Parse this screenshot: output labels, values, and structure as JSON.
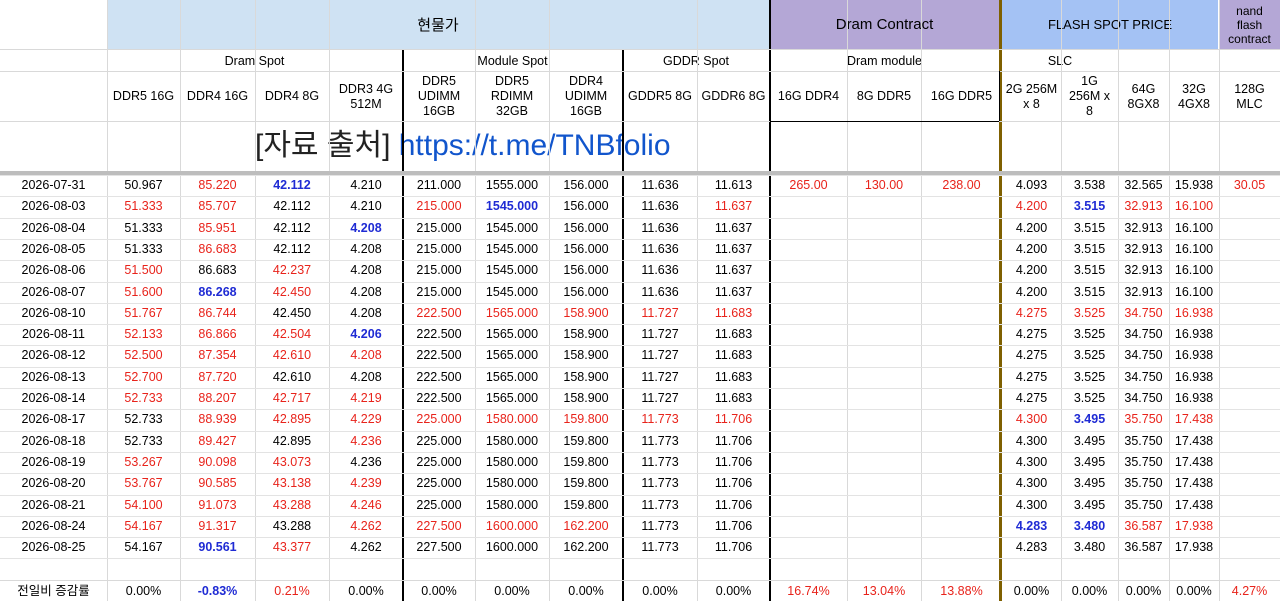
{
  "groups": {
    "spot": "현물가",
    "contract": "Dram Contract",
    "flash": "FLASH SPOT PRICE",
    "nand": "nand flash contract"
  },
  "subgroups": {
    "dram_spot": "Dram Spot",
    "module_spot": "Module Spot",
    "gddr_spot": "GDDR Spot",
    "dram_module": "Dram module",
    "slc": "SLC"
  },
  "columns": [
    "DDR5 16G",
    "DDR4 16G",
    "DDR4 8G",
    "DDR3 4G 512M",
    "DDR5 UDIMM 16GB",
    "DDR5 RDIMM 32GB",
    "DDR4 UDIMM 16GB",
    "GDDR5 8G",
    "GDDR6 8G",
    "16G DDR4",
    "8G DDR5",
    "16G DDR5",
    "2G 256M x 8",
    "1G 256M x 8",
    "64G 8GX8",
    "32G 4GX8",
    "128G MLC"
  ],
  "source": {
    "label": "[자료 출처]",
    "link": "https://t.me/TNBfolio"
  },
  "rows": [
    {
      "date": "2026-07-31",
      "v": [
        "50.967",
        "85.220",
        "42.112",
        "4.210",
        "211.000",
        "1555.000",
        "156.000",
        "11.636",
        "11.613",
        "265.00",
        "130.00",
        "238.00",
        "4.093",
        "3.538",
        "32.565",
        "15.938",
        "30.05"
      ],
      "c": [
        "k",
        "r",
        "b",
        "k",
        "k",
        "k",
        "k",
        "k",
        "k",
        "r",
        "r",
        "r",
        "k",
        "k",
        "k",
        "k",
        "r"
      ]
    },
    {
      "date": "2026-08-03",
      "v": [
        "51.333",
        "85.707",
        "42.112",
        "4.210",
        "215.000",
        "1545.000",
        "156.000",
        "11.636",
        "11.637",
        "",
        "",
        "",
        "4.200",
        "3.515",
        "32.913",
        "16.100",
        ""
      ],
      "c": [
        "r",
        "r",
        "k",
        "k",
        "r",
        "b",
        "k",
        "k",
        "r",
        "k",
        "k",
        "k",
        "r",
        "b",
        "r",
        "r",
        "k"
      ]
    },
    {
      "date": "2026-08-04",
      "v": [
        "51.333",
        "85.951",
        "42.112",
        "4.208",
        "215.000",
        "1545.000",
        "156.000",
        "11.636",
        "11.637",
        "",
        "",
        "",
        "4.200",
        "3.515",
        "32.913",
        "16.100",
        ""
      ],
      "c": [
        "k",
        "r",
        "k",
        "b",
        "k",
        "k",
        "k",
        "k",
        "k",
        "k",
        "k",
        "k",
        "k",
        "k",
        "k",
        "k",
        "k"
      ]
    },
    {
      "date": "2026-08-05",
      "v": [
        "51.333",
        "86.683",
        "42.112",
        "4.208",
        "215.000",
        "1545.000",
        "156.000",
        "11.636",
        "11.637",
        "",
        "",
        "",
        "4.200",
        "3.515",
        "32.913",
        "16.100",
        ""
      ],
      "c": [
        "k",
        "r",
        "k",
        "k",
        "k",
        "k",
        "k",
        "k",
        "k",
        "k",
        "k",
        "k",
        "k",
        "k",
        "k",
        "k",
        "k"
      ]
    },
    {
      "date": "2026-08-06",
      "v": [
        "51.500",
        "86.683",
        "42.237",
        "4.208",
        "215.000",
        "1545.000",
        "156.000",
        "11.636",
        "11.637",
        "",
        "",
        "",
        "4.200",
        "3.515",
        "32.913",
        "16.100",
        ""
      ],
      "c": [
        "r",
        "k",
        "r",
        "k",
        "k",
        "k",
        "k",
        "k",
        "k",
        "k",
        "k",
        "k",
        "k",
        "k",
        "k",
        "k",
        "k"
      ]
    },
    {
      "date": "2026-08-07",
      "v": [
        "51.600",
        "86.268",
        "42.450",
        "4.208",
        "215.000",
        "1545.000",
        "156.000",
        "11.636",
        "11.637",
        "",
        "",
        "",
        "4.200",
        "3.515",
        "32.913",
        "16.100",
        ""
      ],
      "c": [
        "r",
        "b",
        "r",
        "k",
        "k",
        "k",
        "k",
        "k",
        "k",
        "k",
        "k",
        "k",
        "k",
        "k",
        "k",
        "k",
        "k"
      ]
    },
    {
      "date": "2026-08-10",
      "v": [
        "51.767",
        "86.744",
        "42.450",
        "4.208",
        "222.500",
        "1565.000",
        "158.900",
        "11.727",
        "11.683",
        "",
        "",
        "",
        "4.275",
        "3.525",
        "34.750",
        "16.938",
        ""
      ],
      "c": [
        "r",
        "r",
        "k",
        "k",
        "r",
        "r",
        "r",
        "r",
        "r",
        "k",
        "k",
        "k",
        "r",
        "r",
        "r",
        "r",
        "k"
      ]
    },
    {
      "date": "2026-08-11",
      "v": [
        "52.133",
        "86.866",
        "42.504",
        "4.206",
        "222.500",
        "1565.000",
        "158.900",
        "11.727",
        "11.683",
        "",
        "",
        "",
        "4.275",
        "3.525",
        "34.750",
        "16.938",
        ""
      ],
      "c": [
        "r",
        "r",
        "r",
        "b",
        "k",
        "k",
        "k",
        "k",
        "k",
        "k",
        "k",
        "k",
        "k",
        "k",
        "k",
        "k",
        "k"
      ]
    },
    {
      "date": "2026-08-12",
      "v": [
        "52.500",
        "87.354",
        "42.610",
        "4.208",
        "222.500",
        "1565.000",
        "158.900",
        "11.727",
        "11.683",
        "",
        "",
        "",
        "4.275",
        "3.525",
        "34.750",
        "16.938",
        ""
      ],
      "c": [
        "r",
        "r",
        "r",
        "r",
        "k",
        "k",
        "k",
        "k",
        "k",
        "k",
        "k",
        "k",
        "k",
        "k",
        "k",
        "k",
        "k"
      ]
    },
    {
      "date": "2026-08-13",
      "v": [
        "52.700",
        "87.720",
        "42.610",
        "4.208",
        "222.500",
        "1565.000",
        "158.900",
        "11.727",
        "11.683",
        "",
        "",
        "",
        "4.275",
        "3.525",
        "34.750",
        "16.938",
        ""
      ],
      "c": [
        "r",
        "r",
        "k",
        "k",
        "k",
        "k",
        "k",
        "k",
        "k",
        "k",
        "k",
        "k",
        "k",
        "k",
        "k",
        "k",
        "k"
      ]
    },
    {
      "date": "2026-08-14",
      "v": [
        "52.733",
        "88.207",
        "42.717",
        "4.219",
        "222.500",
        "1565.000",
        "158.900",
        "11.727",
        "11.683",
        "",
        "",
        "",
        "4.275",
        "3.525",
        "34.750",
        "16.938",
        ""
      ],
      "c": [
        "r",
        "r",
        "r",
        "r",
        "k",
        "k",
        "k",
        "k",
        "k",
        "k",
        "k",
        "k",
        "k",
        "k",
        "k",
        "k",
        "k"
      ]
    },
    {
      "date": "2026-08-17",
      "v": [
        "52.733",
        "88.939",
        "42.895",
        "4.229",
        "225.000",
        "1580.000",
        "159.800",
        "11.773",
        "11.706",
        "",
        "",
        "",
        "4.300",
        "3.495",
        "35.750",
        "17.438",
        ""
      ],
      "c": [
        "k",
        "r",
        "r",
        "r",
        "r",
        "r",
        "r",
        "r",
        "r",
        "k",
        "k",
        "k",
        "r",
        "b",
        "r",
        "r",
        "k"
      ]
    },
    {
      "date": "2026-08-18",
      "v": [
        "52.733",
        "89.427",
        "42.895",
        "4.236",
        "225.000",
        "1580.000",
        "159.800",
        "11.773",
        "11.706",
        "",
        "",
        "",
        "4.300",
        "3.495",
        "35.750",
        "17.438",
        ""
      ],
      "c": [
        "k",
        "r",
        "k",
        "r",
        "k",
        "k",
        "k",
        "k",
        "k",
        "k",
        "k",
        "k",
        "k",
        "k",
        "k",
        "k",
        "k"
      ]
    },
    {
      "date": "2026-08-19",
      "v": [
        "53.267",
        "90.098",
        "43.073",
        "4.236",
        "225.000",
        "1580.000",
        "159.800",
        "11.773",
        "11.706",
        "",
        "",
        "",
        "4.300",
        "3.495",
        "35.750",
        "17.438",
        ""
      ],
      "c": [
        "r",
        "r",
        "r",
        "k",
        "k",
        "k",
        "k",
        "k",
        "k",
        "k",
        "k",
        "k",
        "k",
        "k",
        "k",
        "k",
        "k"
      ]
    },
    {
      "date": "2026-08-20",
      "v": [
        "53.767",
        "90.585",
        "43.138",
        "4.239",
        "225.000",
        "1580.000",
        "159.800",
        "11.773",
        "11.706",
        "",
        "",
        "",
        "4.300",
        "3.495",
        "35.750",
        "17.438",
        ""
      ],
      "c": [
        "r",
        "r",
        "r",
        "r",
        "k",
        "k",
        "k",
        "k",
        "k",
        "k",
        "k",
        "k",
        "k",
        "k",
        "k",
        "k",
        "k"
      ]
    },
    {
      "date": "2026-08-21",
      "v": [
        "54.100",
        "91.073",
        "43.288",
        "4.246",
        "225.000",
        "1580.000",
        "159.800",
        "11.773",
        "11.706",
        "",
        "",
        "",
        "4.300",
        "3.495",
        "35.750",
        "17.438",
        ""
      ],
      "c": [
        "r",
        "r",
        "r",
        "r",
        "k",
        "k",
        "k",
        "k",
        "k",
        "k",
        "k",
        "k",
        "k",
        "k",
        "k",
        "k",
        "k"
      ]
    },
    {
      "date": "2026-08-24",
      "v": [
        "54.167",
        "91.317",
        "43.288",
        "4.262",
        "227.500",
        "1600.000",
        "162.200",
        "11.773",
        "11.706",
        "",
        "",
        "",
        "4.283",
        "3.480",
        "36.587",
        "17.938",
        ""
      ],
      "c": [
        "r",
        "r",
        "k",
        "r",
        "r",
        "r",
        "r",
        "k",
        "k",
        "k",
        "k",
        "k",
        "b",
        "b",
        "r",
        "r",
        "k"
      ]
    },
    {
      "date": "2026-08-25",
      "v": [
        "54.167",
        "90.561",
        "43.377",
        "4.262",
        "227.500",
        "1600.000",
        "162.200",
        "11.773",
        "11.706",
        "",
        "",
        "",
        "4.283",
        "3.480",
        "36.587",
        "17.938",
        ""
      ],
      "c": [
        "k",
        "b",
        "r",
        "k",
        "k",
        "k",
        "k",
        "k",
        "k",
        "k",
        "k",
        "k",
        "k",
        "k",
        "k",
        "k",
        "k"
      ]
    }
  ],
  "change": {
    "label": "전일비 증감률",
    "v": [
      "0.00%",
      "-0.83%",
      "0.21%",
      "0.00%",
      "0.00%",
      "0.00%",
      "0.00%",
      "0.00%",
      "0.00%",
      "16.74%",
      "13.04%",
      "13.88%",
      "0.00%",
      "0.00%",
      "0.00%",
      "0.00%",
      "4.27%"
    ],
    "c": [
      "k",
      "b",
      "r",
      "k",
      "k",
      "k",
      "k",
      "k",
      "k",
      "r",
      "r",
      "r",
      "k",
      "k",
      "k",
      "k",
      "r"
    ]
  },
  "colors": {
    "spot_header": "#cfe2f3",
    "contract_header": "#b4a7d6",
    "flash_header": "#a4c2f4",
    "up": "#e8231b",
    "down": "#1f2bd4",
    "divider_brown": "#7f6000"
  }
}
